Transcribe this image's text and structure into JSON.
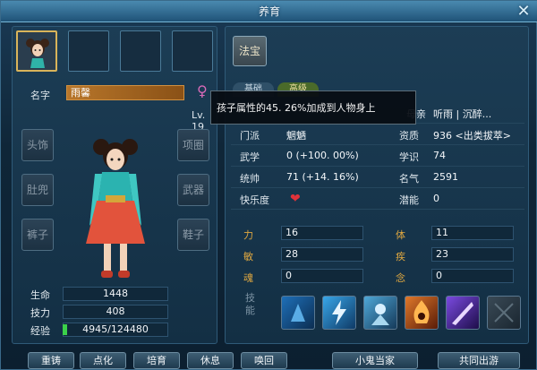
{
  "window": {
    "title": "养育",
    "close_glyph": "✕"
  },
  "portraits": [
    {
      "name": "child-portrait-1",
      "active": true
    },
    {
      "name": "empty-slot-2",
      "active": false
    },
    {
      "name": "empty-slot-3",
      "active": false
    },
    {
      "name": "empty-slot-4",
      "active": false
    }
  ],
  "character": {
    "name_label": "名字",
    "name_value": "雨馨",
    "gender_glyph": "♀",
    "level": "Lv. 19"
  },
  "equipment": {
    "head": "头饰",
    "bib": "肚兜",
    "pants": "裤子",
    "necklace": "项圈",
    "weapon": "武器",
    "shoes": "鞋子"
  },
  "stats": [
    {
      "label": "生命",
      "value": "1448"
    },
    {
      "label": "技力",
      "value": "408"
    },
    {
      "label": "经验",
      "value": "4945/124480"
    }
  ],
  "fabao": {
    "label": "法宝"
  },
  "tabs": {
    "basic": "基础",
    "advanced": "高级"
  },
  "tooltip": {
    "text": "孩子属性的45. 26%加成到人物身上"
  },
  "info": {
    "parent_label": "母亲",
    "parent_value": "听雨 | 沉醉...",
    "sect_label": "门派",
    "sect_value": "魍魉",
    "aptitude_label": "资质",
    "aptitude_value": "936 <出类拔萃>",
    "martial_label": "武学",
    "martial_value": "0 (+100. 00%)",
    "knowledge_label": "学识",
    "knowledge_value": "74",
    "command_label": "统帅",
    "command_value": "71 (+14. 16%)",
    "fame_label": "名气",
    "fame_value": "2591",
    "happiness_label": "快乐度",
    "potential_label": "潜能",
    "potential_value": "0"
  },
  "attributes": [
    {
      "label": "力",
      "value": "16"
    },
    {
      "label": "体",
      "value": "11"
    },
    {
      "label": "敏",
      "value": "28"
    },
    {
      "label": "疾",
      "value": "23"
    },
    {
      "label": "魂",
      "value": "0"
    },
    {
      "label": "念",
      "value": "0"
    }
  ],
  "skills": {
    "label": "技能"
  },
  "bottom_buttons": {
    "recast": "重铸",
    "enlighten": "点化",
    "nurture": "培育",
    "rest": "休息",
    "summon": "唤回",
    "head_of_house": "小鬼当家",
    "tour": "共同出游"
  },
  "colors": {
    "accent_gold": "#d9b45a",
    "attr_gold": "#e0a840",
    "heart": "#e0323a",
    "gender_pink": "#d86ab8"
  }
}
